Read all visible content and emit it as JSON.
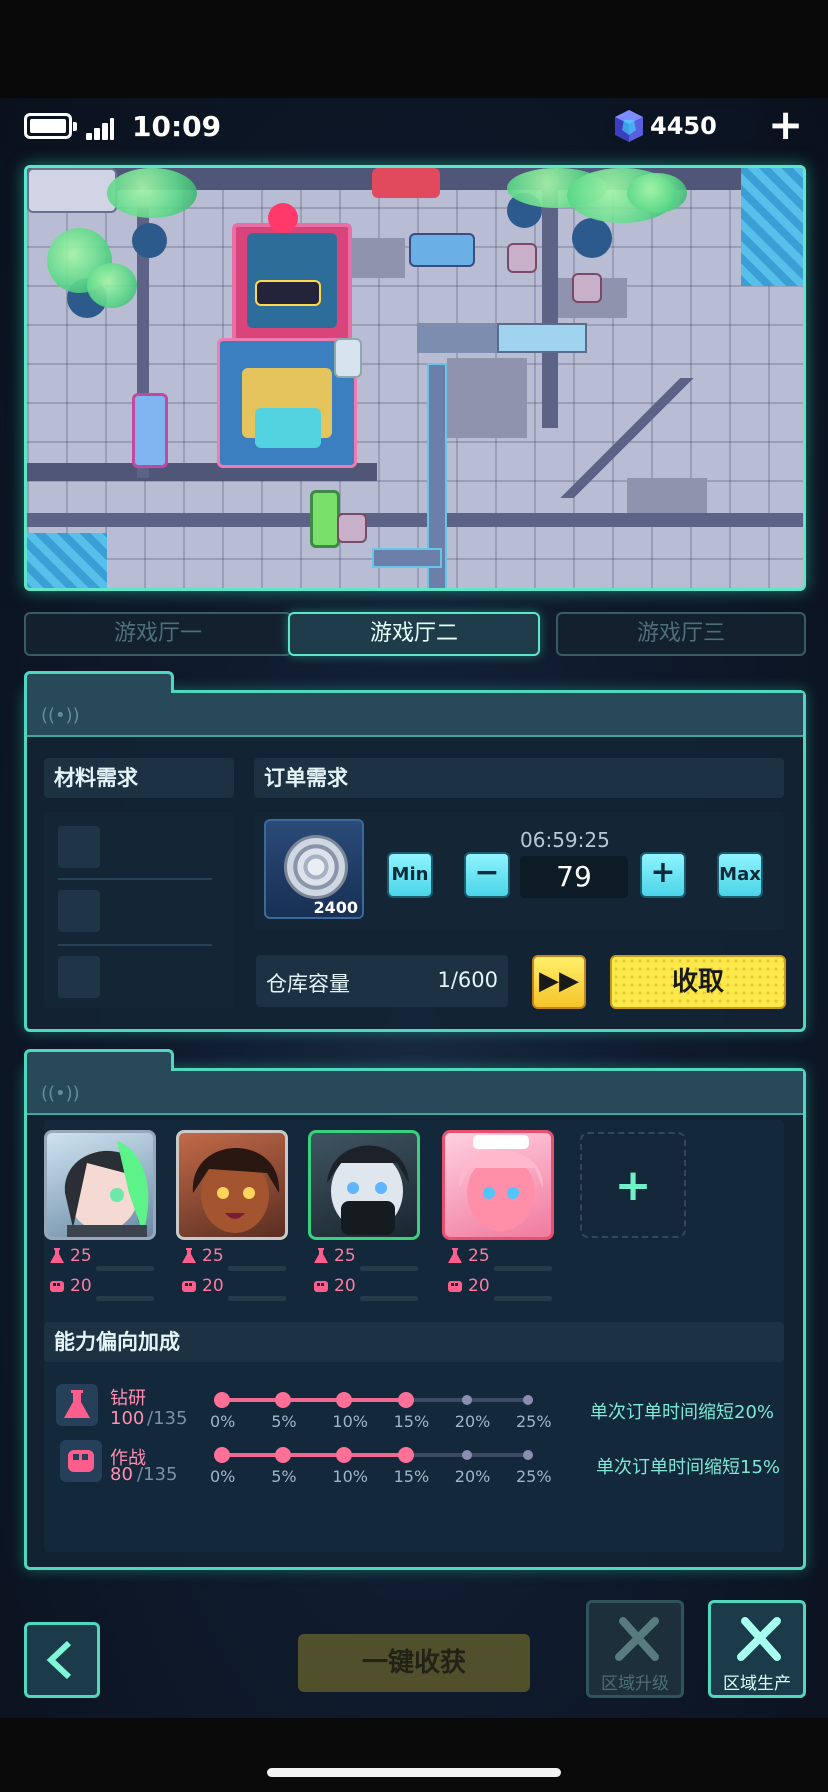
{
  "status_bar": {
    "time": "10:09"
  },
  "currency": {
    "icon": "gem-cube-icon",
    "amount": "4450",
    "accent": "#6f7bff"
  },
  "tabs": [
    {
      "label": "游戏厅一",
      "active": false
    },
    {
      "label": "游戏厅二",
      "active": true
    },
    {
      "label": "游戏厅三",
      "active": false
    }
  ],
  "order_panel": {
    "materials_title": "材料需求",
    "orders_title": "订单需求",
    "item": {
      "icon": "silver-coin-icon",
      "count": "2400"
    },
    "timer": "06:59:25",
    "quantity": "79",
    "min_label": "Min",
    "minus_label": "−",
    "plus_label": "+",
    "max_label": "Max",
    "capacity_label": "仓库容量",
    "capacity_value": "1/600",
    "fast_forward_label": "▶▶",
    "collect_label": "收取"
  },
  "crew_panel": {
    "characters": [
      {
        "name": "green-hair-character",
        "research": "25",
        "combat": "20",
        "border": "#9aa7b8"
      },
      {
        "name": "dark-hair-character",
        "research": "25",
        "combat": "20",
        "border": "#c9c9c9"
      },
      {
        "name": "masked-character",
        "research": "25",
        "combat": "20",
        "border": "#39d07e"
      },
      {
        "name": "pink-hair-character",
        "research": "25",
        "combat": "20",
        "border": "#e8506e"
      }
    ],
    "add_label": "+",
    "bonus_title": "能力偏向加成",
    "bonuses": [
      {
        "name": "钻研",
        "current": "100",
        "max": "/135",
        "level": 4,
        "effect": "单次订单时间缩短20%"
      },
      {
        "name": "作战",
        "current": "80",
        "max": "/135",
        "level": 4,
        "effect": "单次订单时间缩短15%"
      }
    ],
    "percent_ticks": [
      "0%",
      "5%",
      "10%",
      "15%",
      "20%",
      "25%"
    ]
  },
  "bottom": {
    "back_label": "<",
    "harvest_all_label": "一键收获",
    "upgrade_label": "区域升级",
    "produce_label": "区域生产"
  }
}
